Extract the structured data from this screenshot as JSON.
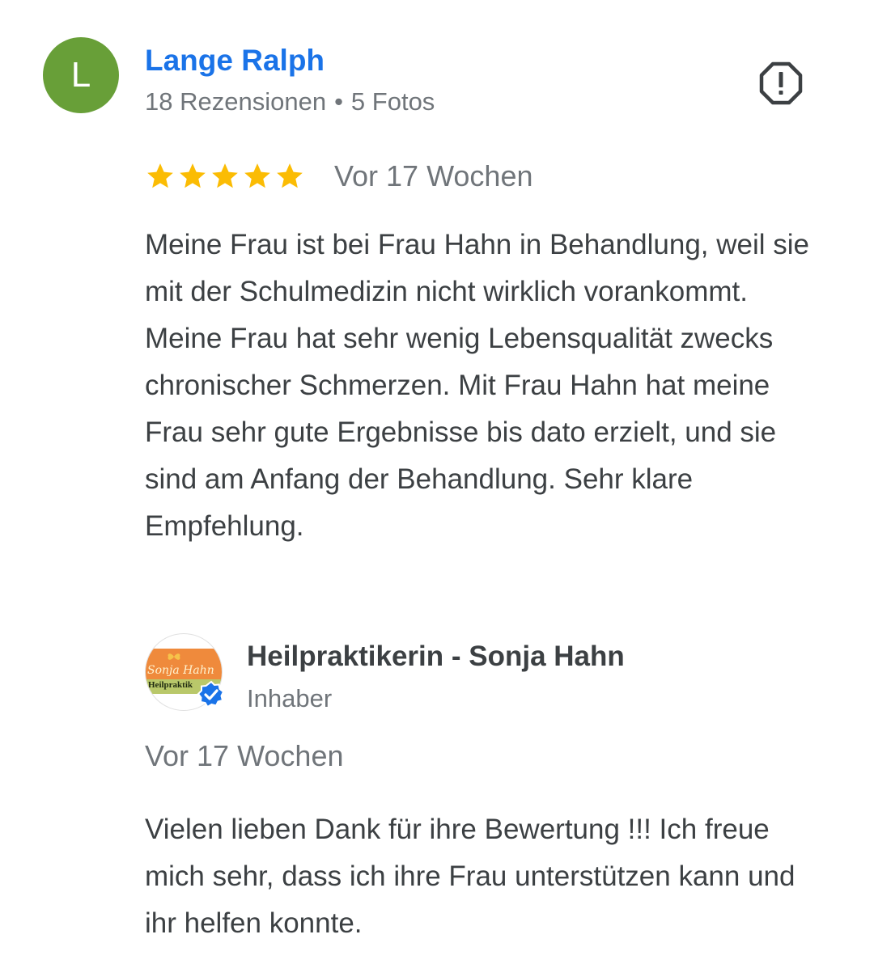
{
  "reviewer": {
    "initial": "L",
    "avatar_color": "#689f38",
    "name": "Lange Ralph",
    "reviews": "18 Rezensionen",
    "separator": "•",
    "photos": "5 Fotos"
  },
  "actions": {
    "report_icon": "report-icon"
  },
  "review": {
    "rating": 5,
    "max_rating": 5,
    "star_color": "#fbbc04",
    "date": "Vor 17 Wochen",
    "text": "Meine Frau ist bei Frau Hahn in Behandlung, weil sie mit der Schulmedizin nicht wirklich vorankommt. Meine Frau hat sehr wenig Lebensqualität zwecks chronischer Schmerzen. Mit Frau Hahn hat meine Frau sehr gute Ergebnisse bis dato erzielt, und sie sind am Anfang der Behandlung. Sehr klare Empfehlung."
  },
  "owner_reply": {
    "logo_text": "Sonja Hahn",
    "logo_subtext": "Heilpraktik",
    "verified_icon": "verified-badge-icon",
    "verified_color": "#1a73e8",
    "name": "Heilpraktikerin - Sonja Hahn",
    "role": "Inhaber",
    "date": "Vor 17 Wochen",
    "text": "Vielen lieben Dank für ihre Bewertung !!! Ich freue mich sehr, dass ich ihre Frau unterstützen kann und ihr helfen konnte."
  }
}
